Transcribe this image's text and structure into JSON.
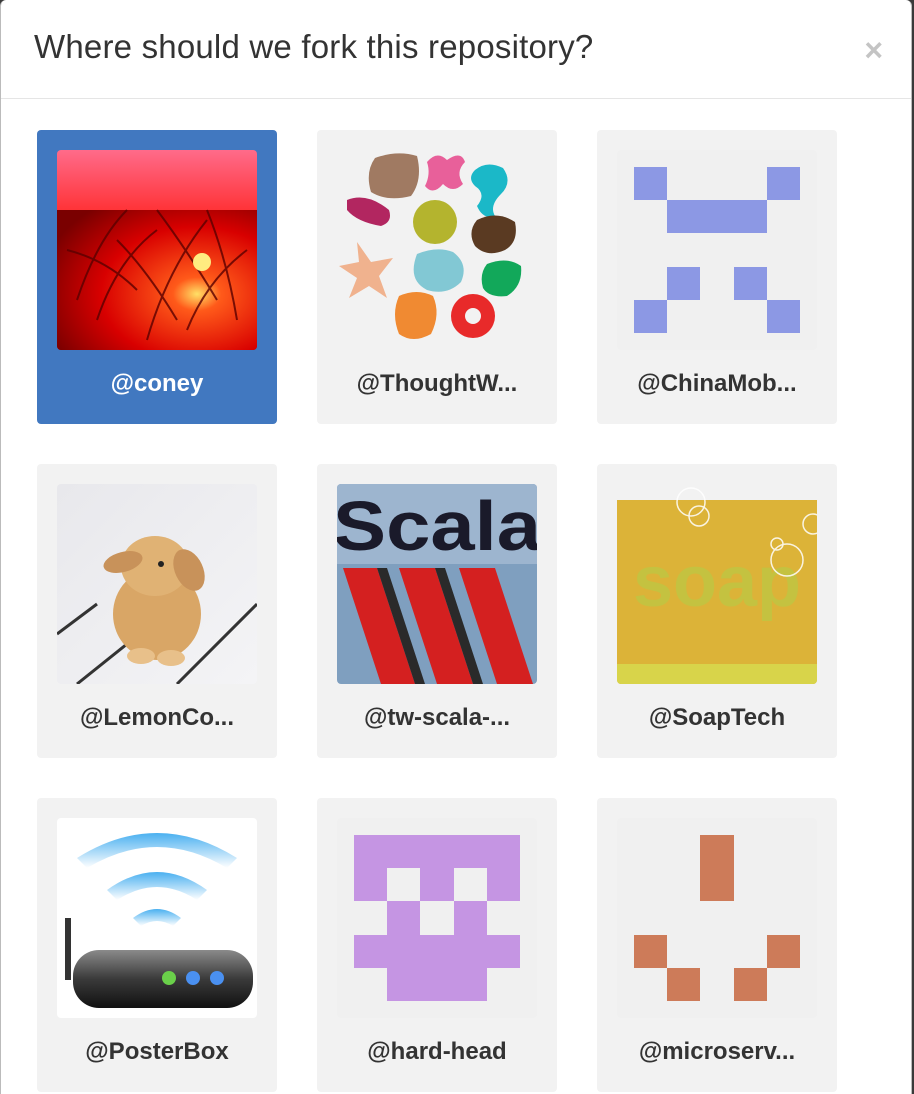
{
  "dialog": {
    "title": "Where should we fork this repository?",
    "close_glyph": "×"
  },
  "accounts": [
    {
      "label": "@coney",
      "selected": true,
      "avatar": "red-flower-photo"
    },
    {
      "label": "@ThoughtW...",
      "selected": false,
      "avatar": "colorful-shapes-logo"
    },
    {
      "label": "@ChinaMob...",
      "selected": false,
      "avatar": "blue-identicon"
    },
    {
      "label": "@LemonCo...",
      "selected": false,
      "avatar": "bunny-photo"
    },
    {
      "label": "@tw-scala-...",
      "selected": false,
      "avatar": "scala-logo"
    },
    {
      "label": "@SoapTech",
      "selected": false,
      "avatar": "soap-image",
      "avatar_text": "soap"
    },
    {
      "label": "@PosterBox",
      "selected": false,
      "avatar": "wifi-router-image"
    },
    {
      "label": "@hard-head",
      "selected": false,
      "avatar": "purple-identicon"
    },
    {
      "label": "@microserv...",
      "selected": false,
      "avatar": "orange-identicon"
    }
  ],
  "colors": {
    "selected_card": "#4178c0",
    "card_bg": "#f2f2f2",
    "blue_identicon": "#8c98e4",
    "purple_identicon": "#c595e3",
    "orange_identicon": "#cd7b59"
  }
}
